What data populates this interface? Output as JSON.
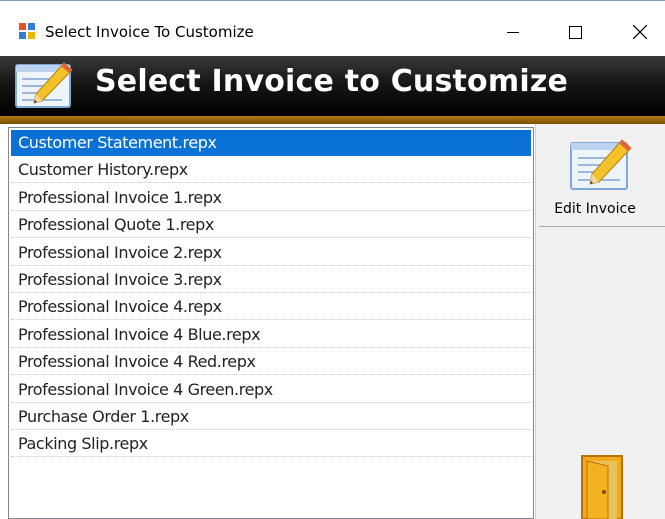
{
  "window": {
    "title": "Select Invoice To Customize",
    "controls": [
      "minimize-icon",
      "maximize-icon",
      "close-icon"
    ]
  },
  "banner": {
    "title": "Select Invoice to Customize",
    "icon": "edit-document-icon"
  },
  "invoice_list": {
    "selected_index": 0,
    "items": [
      {
        "label": "Customer Statement.repx"
      },
      {
        "label": "Customer History.repx"
      },
      {
        "label": "Professional Invoice 1.repx"
      },
      {
        "label": "Professional Quote 1.repx"
      },
      {
        "label": "Professional Invoice 2.repx"
      },
      {
        "label": "Professional Invoice 3.repx"
      },
      {
        "label": "Professional Invoice 4.repx"
      },
      {
        "label": "Professional Invoice 4 Blue.repx"
      },
      {
        "label": "Professional Invoice 4 Red.repx"
      },
      {
        "label": "Professional Invoice 4 Green.repx"
      },
      {
        "label": "Purchase Order 1.repx"
      },
      {
        "label": "Packing Slip.repx"
      }
    ]
  },
  "sidebar": {
    "edit_label": "Edit Invoice",
    "edit_icon": "edit-document-icon",
    "exit_icon": "exit-door-icon"
  },
  "colors": {
    "selection": "#0a72d6",
    "banner": "#111111",
    "banner_stripe": "#9a6510",
    "side_panel": "#f0f0f0"
  }
}
